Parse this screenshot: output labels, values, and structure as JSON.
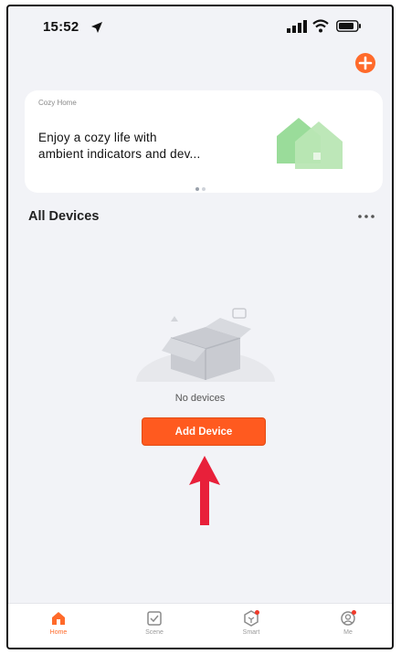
{
  "status_bar": {
    "time": "15:52"
  },
  "banner": {
    "small_title": "Cozy Home",
    "text": "Enjoy a cozy life with ambient indicators and dev..."
  },
  "section": {
    "title": "All Devices"
  },
  "empty_state": {
    "message": "No devices",
    "button_label": "Add Device"
  },
  "tabs": [
    {
      "label": "Home",
      "icon": "home-icon",
      "active": true
    },
    {
      "label": "Scene",
      "icon": "scene-icon",
      "active": false
    },
    {
      "label": "Smart",
      "icon": "smart-icon",
      "active": false
    },
    {
      "label": "Me",
      "icon": "me-icon",
      "active": false
    }
  ],
  "colors": {
    "accent": "#ff5a1f",
    "arrow": "#e8203a",
    "background": "#f2f3f7"
  }
}
